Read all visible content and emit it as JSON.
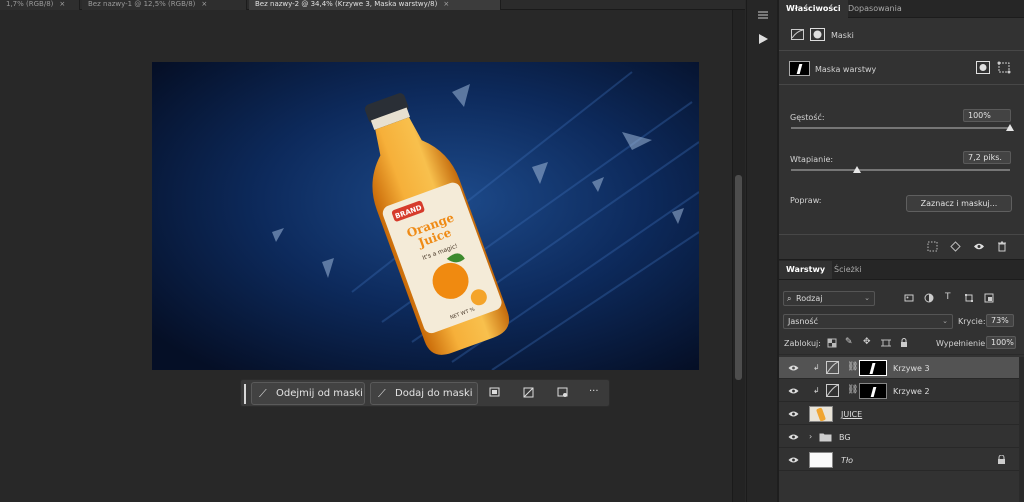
{
  "doc_tabs": [
    {
      "label": "1,7% (RGB/8)",
      "close": "×"
    },
    {
      "label": "Bez nazwy-1 @ 12,5% (RGB/8)",
      "close": "×"
    },
    {
      "label": "Bez nazwy-2 @ 34,4% (Krzywe 3, Maska warstwy/8)",
      "close": "×"
    }
  ],
  "canvas_image": {
    "brand": "BRAND",
    "title_line1": "Orange",
    "title_line2": "Juice",
    "tagline": "It's a magic!",
    "net": "NET WT %"
  },
  "mask_toolbar": {
    "subtract_label": "Odejmij od maski",
    "add_label": "Dodaj do maski",
    "more": "···"
  },
  "properties": {
    "tabs": [
      "Właściwości",
      "Dopasowania"
    ],
    "header": "Maski",
    "layer_mask_label": "Maska warstwy",
    "density_label": "Gęstość:",
    "density_value": "100%",
    "density_level": 1.0,
    "feather_label": "Wtapianie:",
    "feather_value": "7,2 piks.",
    "feather_level": 0.3,
    "refine_label": "Popraw:",
    "select_mask_button": "Zaznacz i maskuj..."
  },
  "layers_panel": {
    "tabs": [
      "Warstwy",
      "Ścieżki"
    ],
    "filter_kind": "Rodzaj",
    "blend_mode": "Jasność",
    "opacity_label": "Krycie:",
    "opacity_value": "73%",
    "lock_label": "Zablokuj:",
    "fill_label": "Wypełnienie:",
    "fill_value": "100%",
    "layers": [
      {
        "name": "Krzywe 3",
        "selected": true
      },
      {
        "name": "Krzywe 2",
        "selected": false
      },
      {
        "name": "JUICE",
        "selected": false
      },
      {
        "name": "BG",
        "selected": false
      },
      {
        "name": "Tło",
        "selected": false
      }
    ]
  },
  "colors": {
    "accent_orange": "#f2a72a",
    "bg_navy": "#0a1b3c",
    "panel": "#323232"
  }
}
